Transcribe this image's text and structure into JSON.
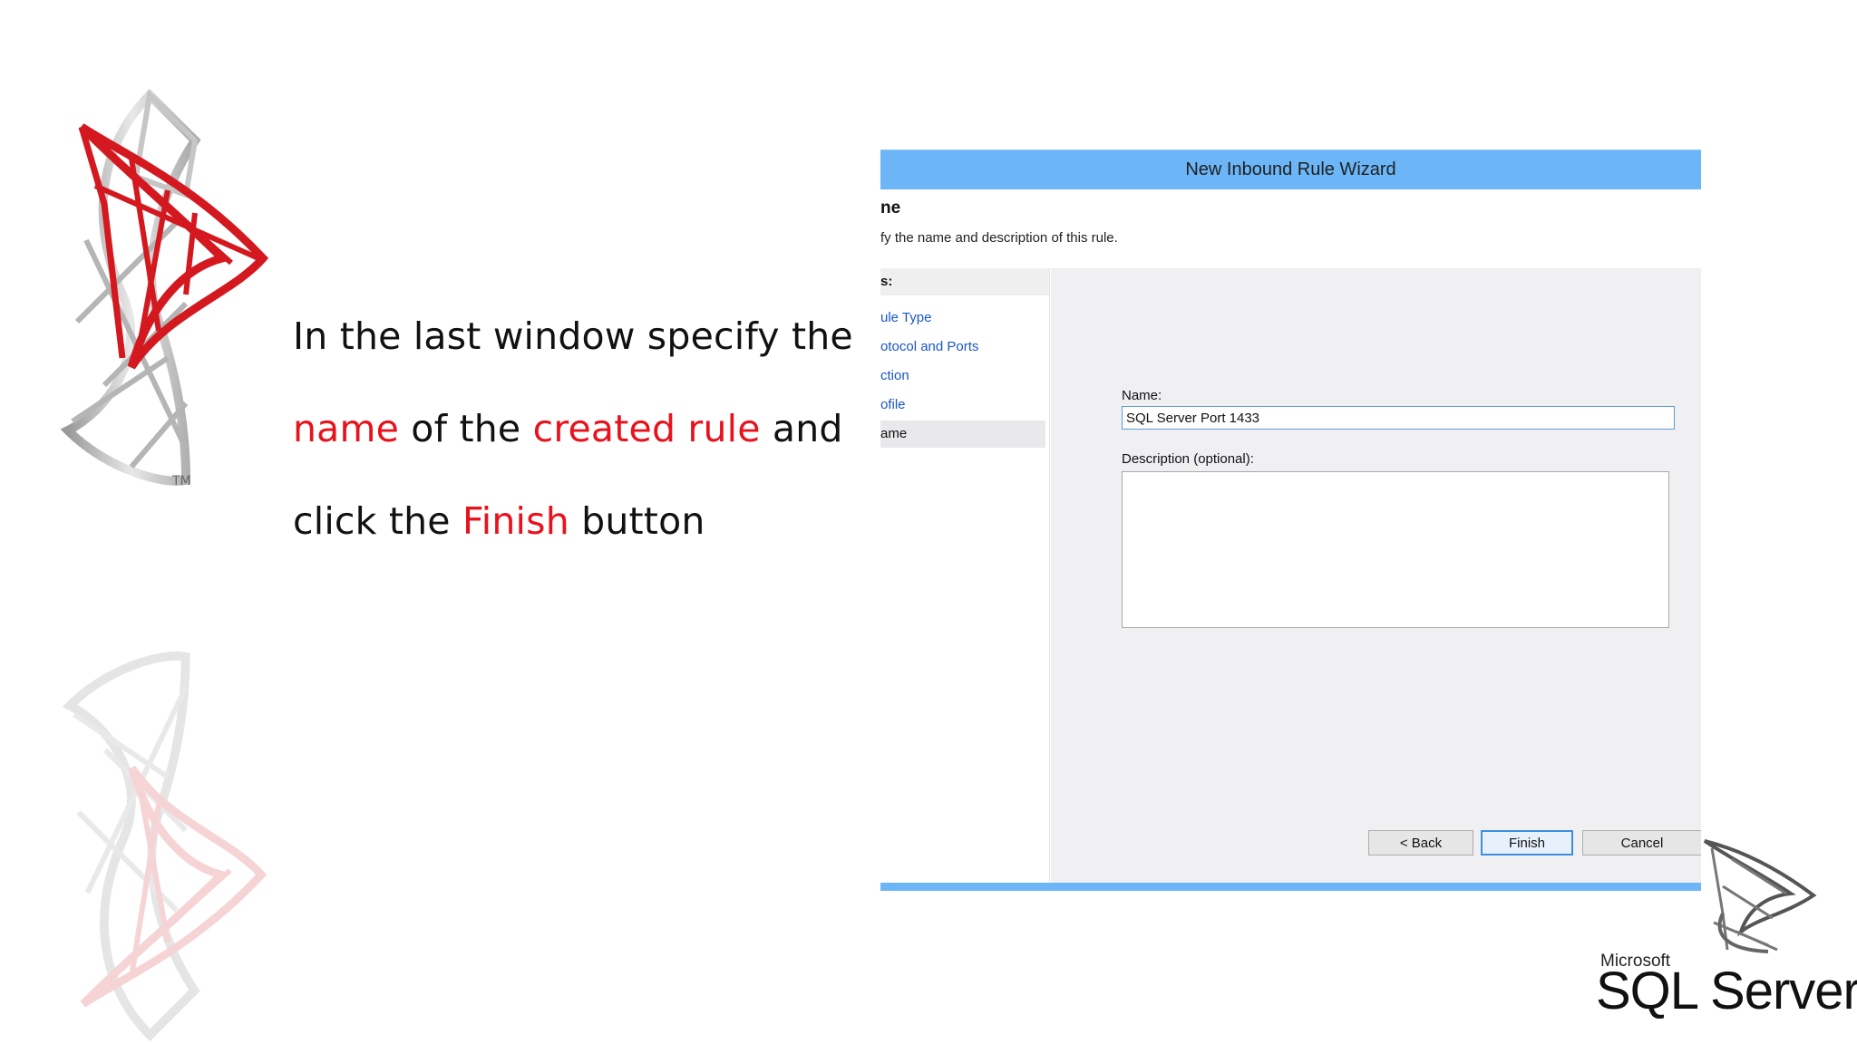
{
  "slide": {
    "line1": "In the last window specify the",
    "line2_a": "name",
    "line2_b": " of the ",
    "line2_c": "created rule",
    "line2_d": " and",
    "line3_a": "click the ",
    "line3_b": "Finish",
    "line3_c": " button",
    "highlight_color": "#e8121c",
    "tm": "TM"
  },
  "wizard": {
    "title": "New Inbound Rule Wizard",
    "header_title": "ne",
    "header_desc": "fy the name and description of this rule.",
    "steps_label": "s:",
    "steps": [
      {
        "label": "ule Type"
      },
      {
        "label": "otocol and Ports"
      },
      {
        "label": "ction"
      },
      {
        "label": "ofile"
      },
      {
        "label": "ame"
      }
    ],
    "name_label": "Name:",
    "name_value": "SQL Server Port 1433",
    "description_label": "Description (optional):",
    "description_value": "",
    "buttons": {
      "back": "< Back",
      "finish": "Finish",
      "cancel": "Cancel"
    },
    "accent_color": "#6cb6f7"
  },
  "brand": {
    "microsoft": "Microsoft",
    "product": "SQL Server"
  }
}
